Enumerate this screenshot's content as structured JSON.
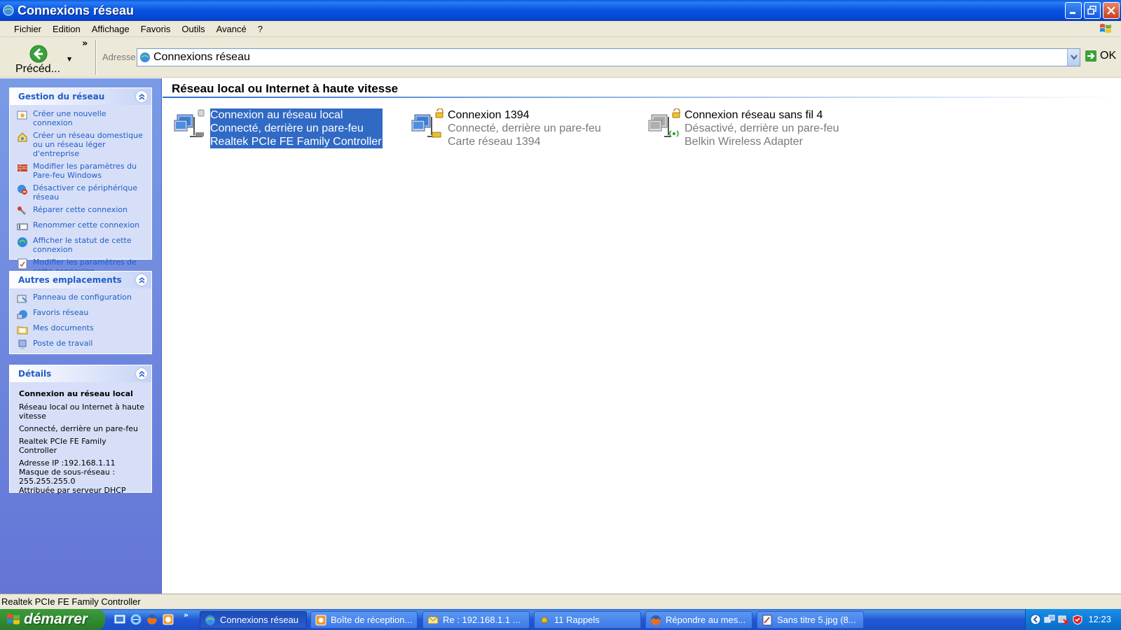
{
  "window": {
    "title": "Connexions réseau"
  },
  "menu": [
    "Fichier",
    "Edition",
    "Affichage",
    "Favoris",
    "Outils",
    "Avancé",
    "?"
  ],
  "toolbar": {
    "back_label": "Précéd...",
    "more": "»",
    "address_label": "Adresse",
    "address_value": "Connexions réseau",
    "go_label": "OK"
  },
  "sidebar": {
    "tasks_panel": {
      "title": "Gestion du réseau",
      "items": [
        "Créer une nouvelle connexion",
        "Créer un réseau domestique ou un réseau léger d'entreprise",
        "Modifier les paramètres du Pare-feu Windows",
        "Désactiver ce périphérique réseau",
        "Réparer cette connexion",
        "Renommer cette connexion",
        "Afficher le statut de cette connexion",
        "Modifier les paramètres de cette connexion"
      ]
    },
    "places_panel": {
      "title": "Autres emplacements",
      "items": [
        "Panneau de configuration",
        "Favoris réseau",
        "Mes documents",
        "Poste de travail"
      ]
    },
    "details_panel": {
      "title": "Détails",
      "name": "Connexion au réseau local",
      "type": "Réseau local ou Internet à haute vitesse",
      "status": "Connecté, derrière un pare-feu",
      "device": "Realtek PCIe FE Family Controller",
      "ip": "Adresse IP :192.168.1.11",
      "mask_label": "Masque de sous-réseau :",
      "mask_value": "255.255.255.0",
      "dhcp": "Attribuée par serveur DHCP"
    }
  },
  "main": {
    "group_title": "Réseau local ou Internet à haute vitesse",
    "connections": [
      {
        "name": "Connexion au réseau local",
        "status": "Connecté, derrière un pare-feu",
        "device": "Realtek PCIe FE Family Controller",
        "selected": true
      },
      {
        "name": "Connexion 1394",
        "status": "Connecté, derrière un pare-feu",
        "device": "Carte réseau 1394",
        "selected": false
      },
      {
        "name": "Connexion réseau sans fil 4",
        "status": "Désactivé, derrière un pare-feu",
        "device": "Belkin Wireless Adapter",
        "selected": false
      }
    ]
  },
  "statusbar": {
    "text": "Realtek PCIe FE Family Controller"
  },
  "taskbar": {
    "start_label": "démarrer",
    "more": "»",
    "buttons": [
      {
        "label": "Connexions réseau",
        "icon": "network-icon",
        "active": true
      },
      {
        "label": "Boîte de réception...",
        "icon": "mail-app-icon",
        "active": false
      },
      {
        "label": "Re : 192.168.1.1 ...",
        "icon": "envelope-icon",
        "active": false
      },
      {
        "label": "11 Rappels",
        "icon": "bell-icon",
        "active": false
      },
      {
        "label": "Répondre au mes...",
        "icon": "firefox-icon",
        "active": false
      },
      {
        "label": "Sans titre 5.jpg (8...",
        "icon": "paint-icon",
        "active": false
      }
    ],
    "clock": "12:23"
  },
  "colors": {
    "titlebar": "#0a5be0",
    "selection": "#316ac5",
    "link": "#215dc6",
    "start": "#3c9a3c"
  }
}
